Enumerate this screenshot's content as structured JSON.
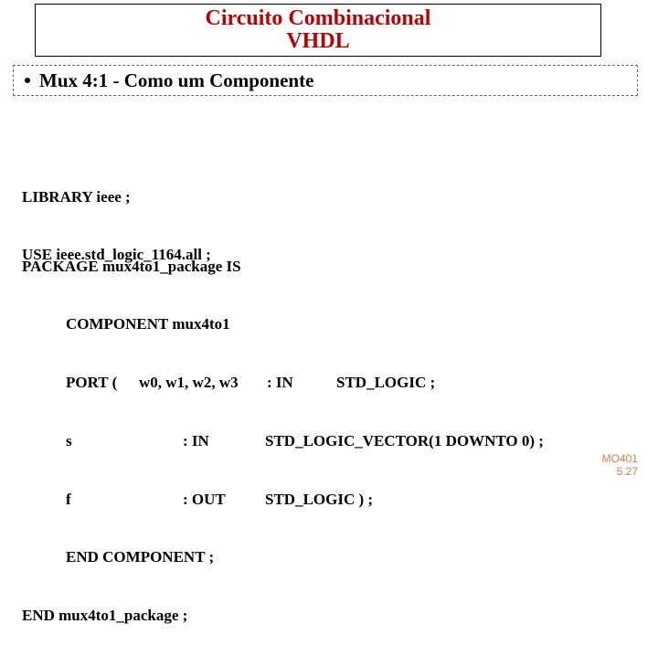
{
  "title": {
    "line1": "Circuito Combinacional",
    "line2": "VHDL"
  },
  "bullet": {
    "text": "Mux 4:1 - Como um Componente"
  },
  "code1": {
    "line1": "LIBRARY ieee ;",
    "line2": "USE ieee.std_logic_1164.all ;"
  },
  "code2": {
    "l1": "PACKAGE mux4to1_package IS",
    "l2": "COMPONENT mux4to1",
    "l3a": "PORT (",
    "l3b": "w0, w1, w2, w3",
    "l3c": ": IN",
    "l3d": "STD_LOGIC ;",
    "l4a": "s",
    "l4b": ": IN",
    "l4c": "STD_LOGIC_VECTOR(1 DOWNTO 0) ;",
    "l5a": "f",
    "l5b": ": OUT",
    "l5c": "STD_LOGIC ) ;",
    "l6": "END COMPONENT ;",
    "l7": "END mux4to1_package ;"
  },
  "footer": {
    "line1": "MO401",
    "line2": "5.27"
  }
}
